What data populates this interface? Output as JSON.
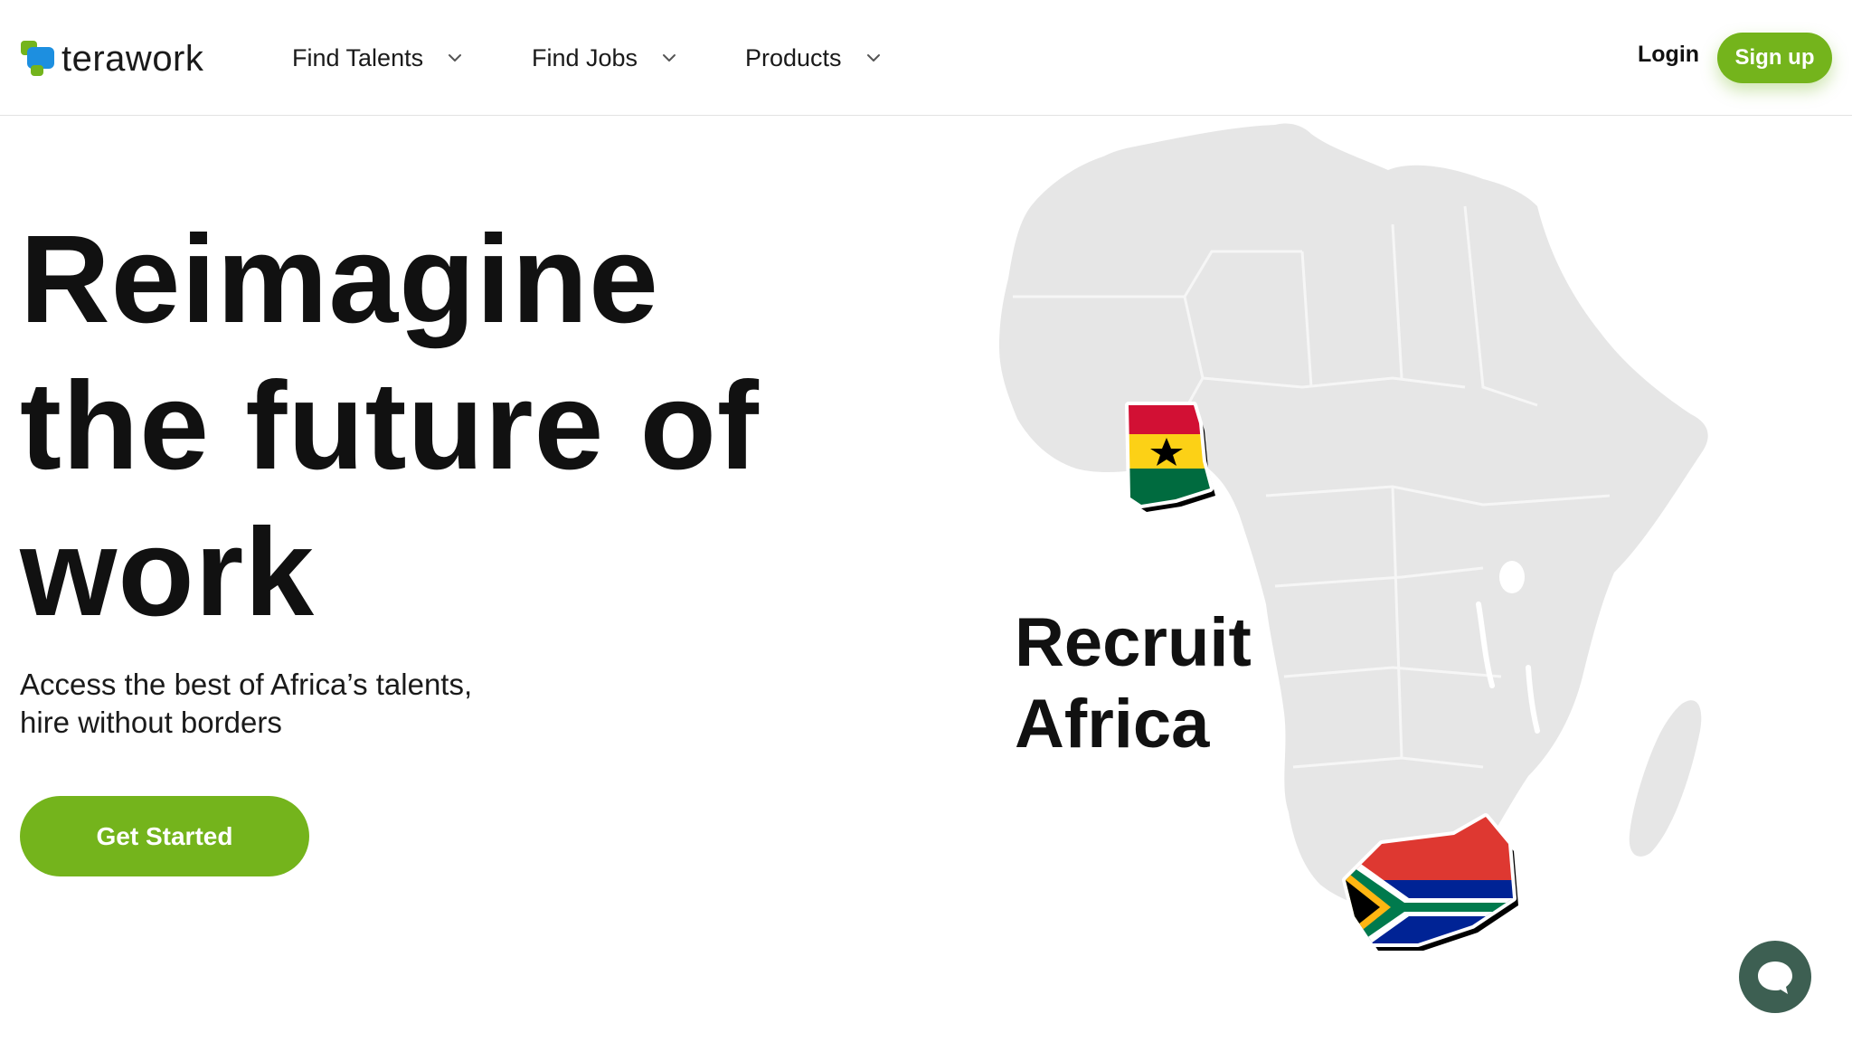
{
  "header": {
    "logo_text": "terawork",
    "nav": [
      {
        "label": "Find Talents"
      },
      {
        "label": "Find Jobs"
      },
      {
        "label": "Products"
      }
    ],
    "login_label": "Login",
    "signup_label": "Sign up"
  },
  "hero": {
    "headline_line1": "Reimagine",
    "headline_line2": "the future of",
    "headline_line3": "work",
    "subtitle_line1": "Access the best of Africa’s talents,",
    "subtitle_line2": "hire without borders",
    "cta_label": "Get Started"
  },
  "map": {
    "caption_line1": "Recruit",
    "caption_line2": "Africa",
    "flags": [
      "ghana-flag-icon",
      "south-africa-flag-icon"
    ]
  },
  "colors": {
    "accent": "#74b41c",
    "chat_button": "#3d5f52",
    "map_fill": "#e6e6e6"
  },
  "icons": {
    "chat": "chat-bubble-icon",
    "chevron": "chevron-down-icon"
  }
}
